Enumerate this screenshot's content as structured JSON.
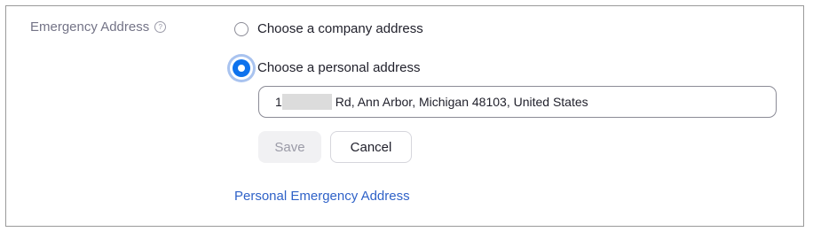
{
  "field": {
    "label": "Emergency Address",
    "help_icon": "help-circle-icon",
    "help_glyph": "?"
  },
  "options": [
    {
      "label": "Choose a company address",
      "selected": false
    },
    {
      "label": "Choose a personal address",
      "selected": true
    }
  ],
  "address_input": {
    "value_prefix": "1",
    "value_suffix": "Rd, Ann Arbor, Michigan 48103, United States"
  },
  "buttons": {
    "save": "Save",
    "cancel": "Cancel"
  },
  "link": {
    "label": "Personal Emergency Address"
  },
  "colors": {
    "accent": "#0e72ed",
    "link": "#2f62c8",
    "label": "#747487"
  }
}
